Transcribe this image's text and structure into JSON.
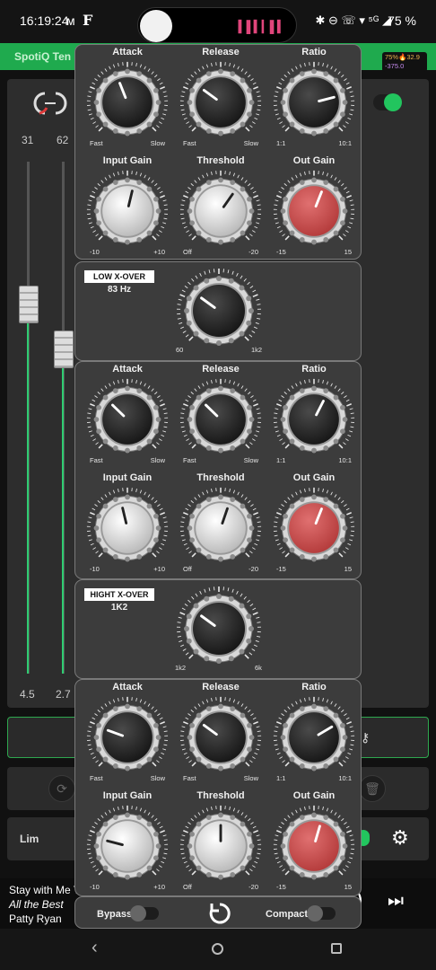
{
  "status_bar": {
    "time": "16:19:24",
    "carrier_glyph": "ᴍ",
    "app_glyph": "F",
    "right_icons": "✱ ⊖ ☏ ▾ ⁵ᴳ ◢",
    "battery": "75 %"
  },
  "app": {
    "title": "SpotiQ Ten",
    "perf_line1": "75%🔥32.9",
    "perf_line2": "-375.0",
    "faders": {
      "left_top": "31",
      "right_top": "62",
      "left_bottom": "4.5",
      "right_bottom": "2.7"
    },
    "limiter_label": "Lim",
    "colors": {
      "accent": "#1faa4e",
      "toggle_on": "#22c55e",
      "out_gain_knob": "#c44848"
    }
  },
  "now_playing": {
    "title": "Stay with Me T",
    "album": "All the Best",
    "artist": "Patty Ryan"
  },
  "compressor": {
    "low_band": {
      "knobs": [
        {
          "title": "Attack",
          "min": "Fast",
          "max": "Slow",
          "value": 0.42,
          "red": false
        },
        {
          "title": "Release",
          "min": "Fast",
          "max": "Slow",
          "value": 0.3,
          "red": false
        },
        {
          "title": "Ratio",
          "min": "1:1",
          "max": "10:1",
          "value": 0.78,
          "red": false
        },
        {
          "title": "Input Gain",
          "min": "-10",
          "max": "+10",
          "value": 0.55,
          "red": false
        },
        {
          "title": "Threshold",
          "min": "Off",
          "max": "-20",
          "value": 0.63,
          "red": false
        },
        {
          "title": "Out Gain",
          "min": "-15",
          "max": "15",
          "value": 0.58,
          "red": true
        }
      ]
    },
    "low_xover": {
      "label": "LOW X-OVER",
      "value": "83 Hz",
      "min": "60",
      "max": "1k2",
      "level": 0.3
    },
    "mid_band": {
      "knobs": [
        {
          "title": "Attack",
          "min": "Fast",
          "max": "Slow",
          "value": 0.33,
          "red": false
        },
        {
          "title": "Release",
          "min": "Fast",
          "max": "Slow",
          "value": 0.33,
          "red": false
        },
        {
          "title": "Ratio",
          "min": "1:1",
          "max": "10:1",
          "value": 0.6,
          "red": false
        },
        {
          "title": "Input Gain",
          "min": "-10",
          "max": "+10",
          "value": 0.45,
          "red": false
        },
        {
          "title": "Threshold",
          "min": "Off",
          "max": "-20",
          "value": 0.57,
          "red": false
        },
        {
          "title": "Out Gain",
          "min": "-15",
          "max": "15",
          "value": 0.58,
          "red": true
        }
      ]
    },
    "high_xover": {
      "label": "HIGHT X-OVER",
      "value": "1K2",
      "min": "1k2",
      "max": "6k",
      "level": 0.3
    },
    "high_band": {
      "knobs": [
        {
          "title": "Attack",
          "min": "Fast",
          "max": "Slow",
          "value": 0.24,
          "red": false
        },
        {
          "title": "Release",
          "min": "Fast",
          "max": "Slow",
          "value": 0.3,
          "red": false
        },
        {
          "title": "Ratio",
          "min": "1:1",
          "max": "10:1",
          "value": 0.72,
          "red": false
        },
        {
          "title": "Input Gain",
          "min": "-10",
          "max": "+10",
          "value": 0.22,
          "red": false
        },
        {
          "title": "Threshold",
          "min": "Off",
          "max": "-20",
          "value": 0.5,
          "red": false
        },
        {
          "title": "Out Gain",
          "min": "-15",
          "max": "15",
          "value": 0.56,
          "red": true
        }
      ]
    },
    "footer": {
      "bypass_label": "Bypass",
      "compact_label": "Compact",
      "bypass_on": false,
      "compact_on": false
    }
  }
}
